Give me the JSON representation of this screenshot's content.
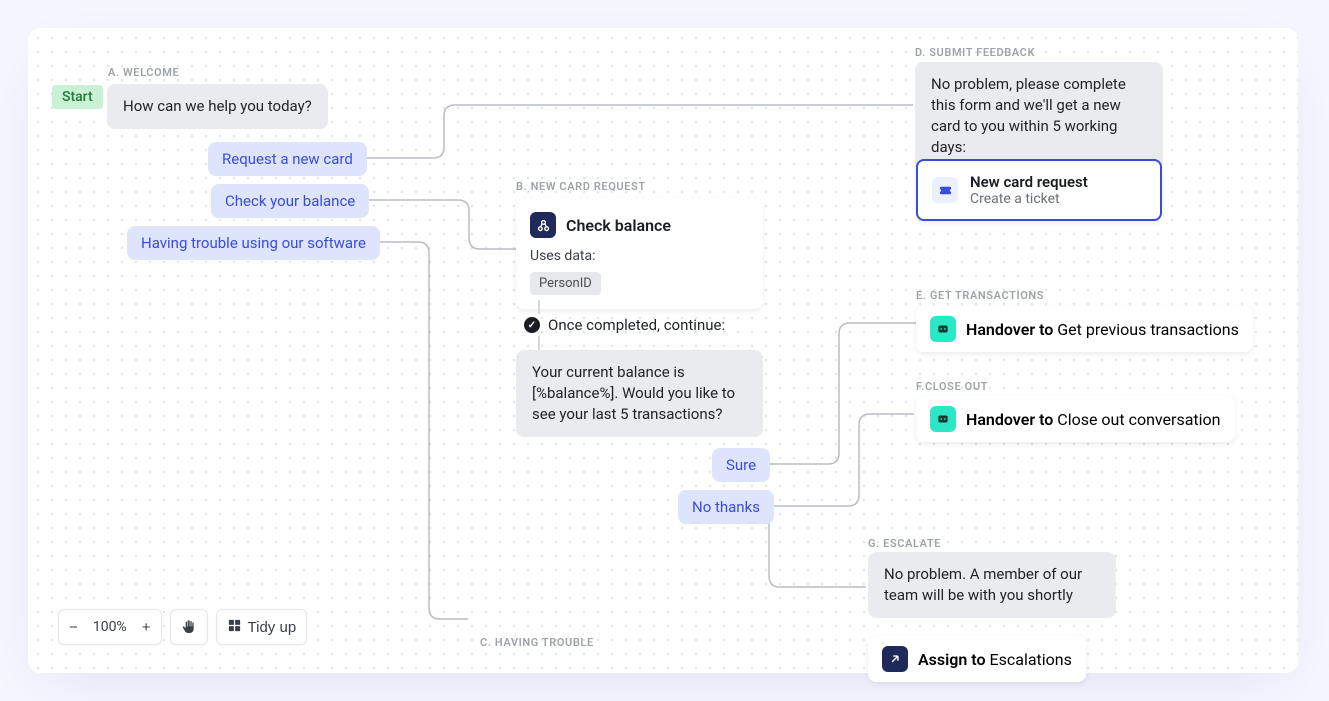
{
  "sections": {
    "a": "A. WELCOME",
    "b": "B. NEW CARD REQUEST",
    "c": "C. HAVING TROUBLE",
    "d": "D. SUBMIT FEEDBACK",
    "e": "E. GET TRANSACTIONS",
    "f": "F.CLOSE OUT",
    "g": "G. ESCALATE"
  },
  "start": "Start",
  "welcome": {
    "msg": "How can we help you today?",
    "opts": [
      "Request a new card",
      "Check your balance",
      "Having trouble using our software"
    ]
  },
  "check_balance": {
    "title": "Check balance",
    "uses_label": "Uses data:",
    "data_pill": "PersonID",
    "continue": "Once completed, continue:",
    "response": "Your current balance is [%balance%]. Would you like to see your last 5 transactions?",
    "opts": [
      "Sure",
      "No thanks"
    ]
  },
  "submit_feedback": {
    "msg": "No problem, please complete this form and we'll get a new card to you within 5 working days:",
    "ticket_title": "New card request",
    "ticket_sub": "Create a ticket"
  },
  "get_transactions": {
    "prefix": "Handover to ",
    "target": "Get previous transactions"
  },
  "close_out": {
    "prefix": "Handover to ",
    "target": "Close out conversation"
  },
  "escalate": {
    "msg": "No problem. A member of our team will be with you shortly",
    "assign_prefix": "Assign to ",
    "assign_target": "Escalations"
  },
  "toolbar": {
    "zoom": "100%",
    "tidy": "Tidy up"
  }
}
